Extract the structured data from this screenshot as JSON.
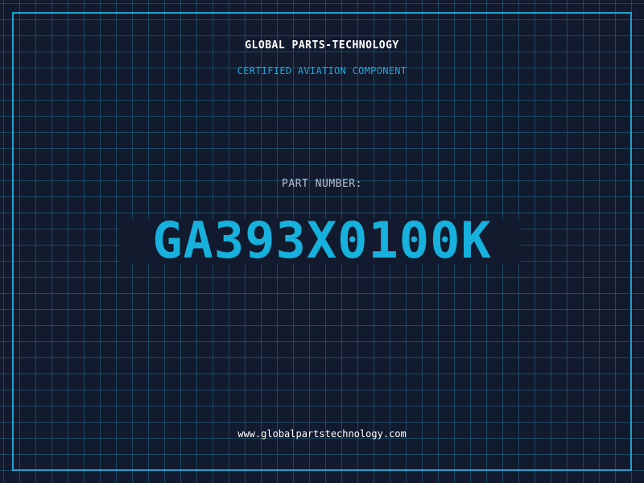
{
  "card": {
    "company": "GLOBAL PARTS-TECHNOLOGY",
    "tagline": "CERTIFIED AVIATION COMPONENT",
    "part_number_label": "PART NUMBER:",
    "part_number": "GA393X0100K",
    "website": "www.globalpartstechnology.com"
  },
  "colors": {
    "background": "#121a2e",
    "grid": "#1e6e8c",
    "accent": "#16b1dc",
    "text": "#ffffff",
    "muted_text": "#b9c0cc"
  }
}
